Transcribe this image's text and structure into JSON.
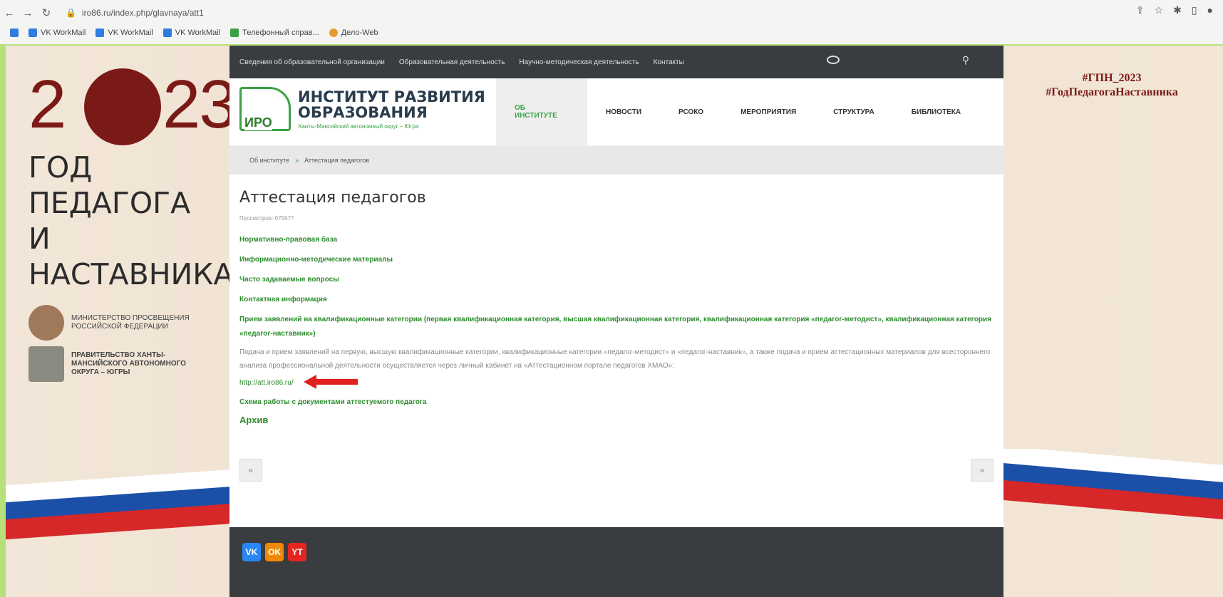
{
  "browser": {
    "url": "iro86.ru/index.php/glavnaya/att1",
    "bookmarks": [
      "VK WorkMail",
      "VK WorkMail",
      "VK WorkMail",
      "Телефонный справ...",
      "Дело-Web"
    ]
  },
  "left_banner": {
    "year_left": "2",
    "year_right": "23",
    "title_line1": "ГОД ПЕДАГОГА",
    "title_line2": "И НАСТАВНИКА",
    "ministry": "МИНИСТЕРСТВО ПРОСВЕЩЕНИЯ РОССИЙСКОЙ ФЕДЕРАЦИИ",
    "government": "ПРАВИТЕЛЬСТВО ХАНТЫ-МАНСИЙСКОГО АВТОНОМНОГО ОКРУГА – ЮГРЫ"
  },
  "right_banner": {
    "tag1": "#ГПН_2023",
    "tag2": "#ГодПедагогаНаставника"
  },
  "topbar": {
    "items": [
      "Сведения об образовательной организации",
      "Образовательная деятельность",
      "Научно-методическая деятельность",
      "Контакты"
    ]
  },
  "logo": {
    "abbr": "ИРО",
    "title_line1": "ИНСТИТУТ РАЗВИТИЯ",
    "title_line2": "ОБРАЗОВАНИЯ",
    "subtitle": "Ханты-Мансийский автономный округ – Югра"
  },
  "menu": {
    "items": [
      "ОБ ИНСТИТУТЕ",
      "НОВОСТИ",
      "РСОКО",
      "МЕРОПРИЯТИЯ",
      "СТРУКТУРА",
      "БИБЛИОТЕКА"
    ]
  },
  "breadcrumb": {
    "home": "Об институте",
    "current": "Аттестация педагогов"
  },
  "content": {
    "title": "Аттестация педагогов",
    "views": "Просмотров: 075977",
    "links": [
      "Нормативно-правовая база",
      "Информационно-методические материалы",
      "Часто задаваемые вопросы",
      "Контактная информация"
    ],
    "application_link": "Прием заявлений на квалификационные категории (первая квалификационная категория, высшая квалификационная категория, квалификационная категория «педагог-методист», квалификационная категория «педагог-наставник»)",
    "description": "Подача и прием заявлений на первую, высшую квалификационные категории, квалификационные категории «педагог-методист» и «педагог-наставник», а также подача и прием аттестационных материалов для всестороннего анализа профессиональной деятельности осуществляется через личный кабинет на «Аттестационном портале педагогов ХМАО»:",
    "portal_url": "http://att.iro86.ru/",
    "scheme_link": "Схема работы с документами аттестуемого педагога",
    "archive": "Архив",
    "prev": "«",
    "next": "»"
  },
  "footer": {
    "social": [
      "VK",
      "OK",
      "YT"
    ]
  },
  "colors": {
    "accent_green": "#2d8c2d",
    "dark_bar": "#3a3d40",
    "banner_red": "#7a1a17",
    "arrow_red": "#e02020"
  }
}
